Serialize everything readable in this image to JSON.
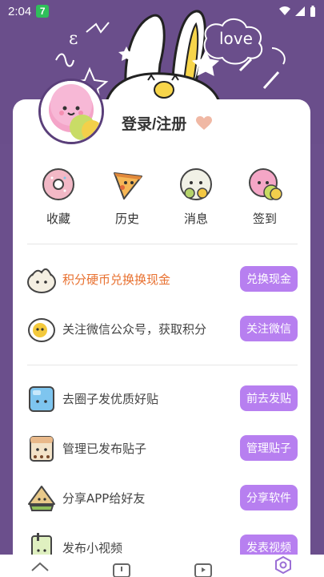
{
  "status": {
    "time": "2:04",
    "app_badge": "7"
  },
  "profile": {
    "login_label": "登录/注册",
    "heart_icon": "heart-icon",
    "doodle_text": "love"
  },
  "quick": [
    {
      "label": "收藏",
      "icon": "donut-icon"
    },
    {
      "label": "历史",
      "icon": "pizza-icon"
    },
    {
      "label": "消息",
      "icon": "rice-ball-icon"
    },
    {
      "label": "签到",
      "icon": "macaron-icon"
    }
  ],
  "tasks": [
    {
      "text": "积分硬币兑换换现金",
      "button": "兑换现金",
      "icon": "dumpling-icon",
      "highlight": true
    },
    {
      "text": "关注微信公众号，获取积分",
      "button": "关注微信",
      "icon": "egg-icon",
      "highlight": false
    },
    {
      "text": "去圈子发优质好贴",
      "button": "前去发贴",
      "icon": "ice-cube-icon",
      "highlight": false
    },
    {
      "text": "管理已发布贴子",
      "button": "管理贴子",
      "icon": "bubble-tea-icon",
      "highlight": false
    },
    {
      "text": "分享APP给好友",
      "button": "分享软件",
      "icon": "sandwich-icon",
      "highlight": false
    },
    {
      "text": "发布小视频",
      "button": "发表视频",
      "icon": "drink-icon",
      "highlight": false
    }
  ],
  "colors": {
    "purple": "#6a4e8b",
    "button": "#b77ff0",
    "highlight": "#e8702f"
  }
}
